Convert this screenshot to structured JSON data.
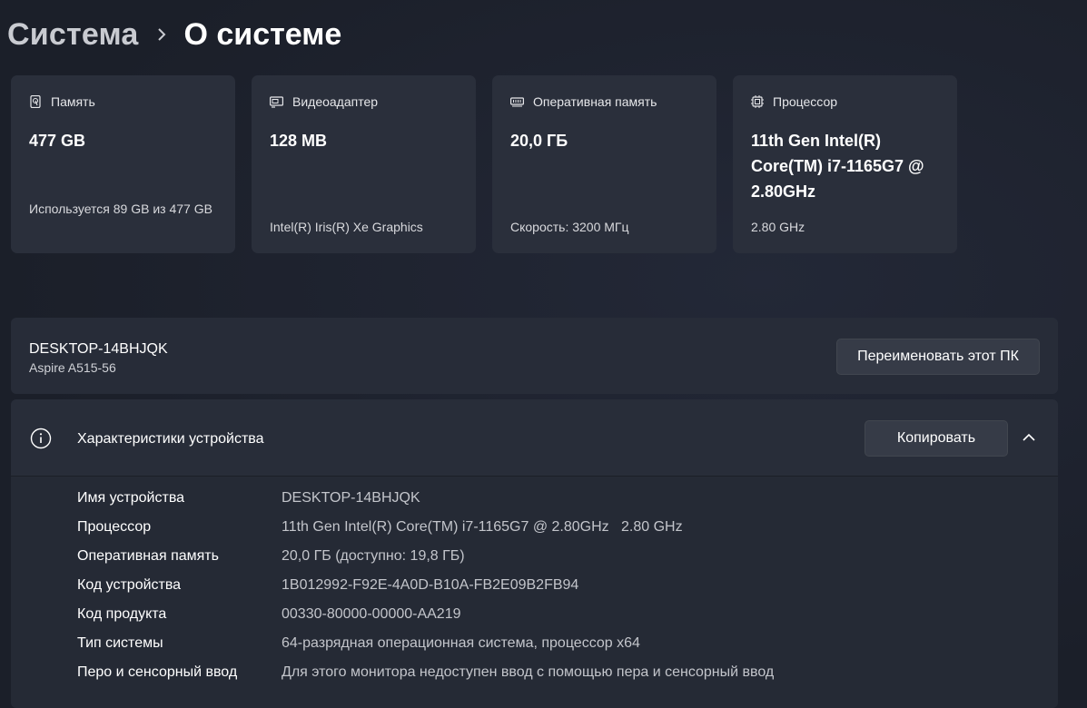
{
  "breadcrumb": {
    "parent": "Система",
    "current": "О системе"
  },
  "cards": [
    {
      "icon": "storage-drive-icon",
      "title": "Память",
      "value": "477 GB",
      "sub": "Используется 89 GB из 477 GB"
    },
    {
      "icon": "display-adapter-icon",
      "title": "Видеоадаптер",
      "value": "128 MB",
      "sub": "Intel(R) Iris(R) Xe Graphics"
    },
    {
      "icon": "ram-icon",
      "title": "Оперативная память",
      "value": "20,0 ГБ",
      "sub": "Скорость: 3200 МГц"
    },
    {
      "icon": "cpu-icon",
      "title": "Процессор",
      "value": "11th Gen Intel(R) Core(TM) i7-1165G7 @ 2.80GHz",
      "sub": "2.80 GHz"
    }
  ],
  "pc": {
    "name": "DESKTOP-14BHJQK",
    "model": "Aspire A515-56",
    "rename_label": "Переименовать этот ПК"
  },
  "specs": {
    "title": "Характеристики устройства",
    "copy_label": "Копировать",
    "rows": [
      {
        "label": "Имя устройства",
        "value": "DESKTOP-14BHJQK"
      },
      {
        "label": "Процессор",
        "value": "11th Gen Intel(R) Core(TM) i7-1165G7 @ 2.80GHz   2.80 GHz"
      },
      {
        "label": "Оперативная память",
        "value": "20,0 ГБ (доступно: 19,8 ГБ)"
      },
      {
        "label": "Код устройства",
        "value": "1B012992-F92E-4A0D-B10A-FB2E09B2FB94"
      },
      {
        "label": "Код продукта",
        "value": "00330-80000-00000-AA219"
      },
      {
        "label": "Тип системы",
        "value": "64-разрядная операционная система, процессор x64"
      },
      {
        "label": "Перо и сенсорный ввод",
        "value": "Для этого монитора недоступен ввод с помощью пера и сенсорный ввод"
      }
    ]
  },
  "colors": {
    "background": "#1c212b",
    "card": "#2a2f3b",
    "button": "#363b47"
  }
}
